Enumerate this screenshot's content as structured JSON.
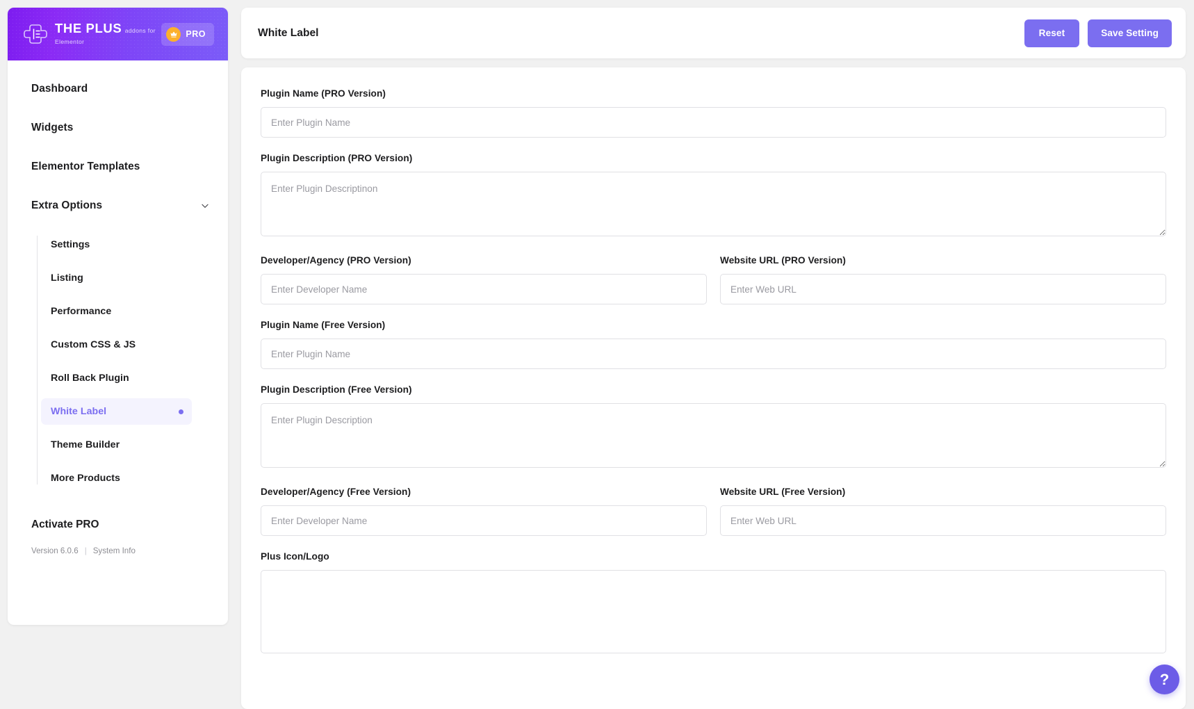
{
  "sidebar": {
    "brand": {
      "title": "THE PLUS",
      "subtitle": "addons for Elementor",
      "pro_label": "PRO",
      "logo_icon": "plus-logo-icon",
      "crown_icon": "crown-icon",
      "gradient_from": "#7d1cf0",
      "gradient_to": "#7b5cf8"
    },
    "items": [
      {
        "label": "Dashboard",
        "name": "dashboard"
      },
      {
        "label": "Widgets",
        "name": "widgets"
      },
      {
        "label": "Elementor Templates",
        "name": "elementor-templates"
      },
      {
        "label": "Extra Options",
        "name": "extra-options",
        "expanded": true,
        "chevron_icon": "chevron-down-icon"
      }
    ],
    "submenu": [
      {
        "label": "Settings",
        "name": "settings",
        "active": false
      },
      {
        "label": "Listing",
        "name": "listing",
        "active": false
      },
      {
        "label": "Performance",
        "name": "performance",
        "active": false
      },
      {
        "label": "Custom CSS & JS",
        "name": "custom-css-js",
        "active": false
      },
      {
        "label": "Roll Back Plugin",
        "name": "roll-back-plugin",
        "active": false
      },
      {
        "label": "White Label",
        "name": "white-label",
        "active": true
      },
      {
        "label": "Theme Builder",
        "name": "theme-builder",
        "active": false
      },
      {
        "label": "More Products",
        "name": "more-products",
        "active": false
      }
    ],
    "activate_pro": "Activate PRO",
    "version": "Version 6.0.6",
    "separator": "|",
    "system_info": "System Info",
    "active_color": "#7b6ef0"
  },
  "topbar": {
    "title": "White Label",
    "reset_label": "Reset",
    "save_label": "Save Setting",
    "button_color": "#7b6ef0"
  },
  "form": {
    "plugin_name_pro": {
      "label": "Plugin Name (PRO Version)",
      "placeholder": "Enter Plugin Name",
      "value": ""
    },
    "plugin_description_pro": {
      "label": "Plugin Description (PRO Version)",
      "placeholder": "Enter Plugin Descriptinon",
      "value": ""
    },
    "developer_pro": {
      "label": "Developer/Agency (PRO Version)",
      "placeholder": "Enter Developer Name",
      "value": ""
    },
    "website_url_pro": {
      "label": "Website URL (PRO Version)",
      "placeholder": "Enter Web URL",
      "value": ""
    },
    "plugin_name_free": {
      "label": "Plugin Name (Free Version)",
      "placeholder": "Enter Plugin Name",
      "value": ""
    },
    "plugin_description_free": {
      "label": "Plugin Description (Free Version)",
      "placeholder": "Enter Plugin Description",
      "value": ""
    },
    "developer_free": {
      "label": "Developer/Agency (Free Version)",
      "placeholder": "Enter Developer Name",
      "value": ""
    },
    "website_url_free": {
      "label": "Website URL (Free Version)",
      "placeholder": "Enter Web URL",
      "value": ""
    },
    "plus_icon_logo": {
      "label": "Plus Icon/Logo"
    }
  },
  "help": {
    "icon": "question-mark-icon",
    "label": "?",
    "color": "#6c5ce7"
  }
}
